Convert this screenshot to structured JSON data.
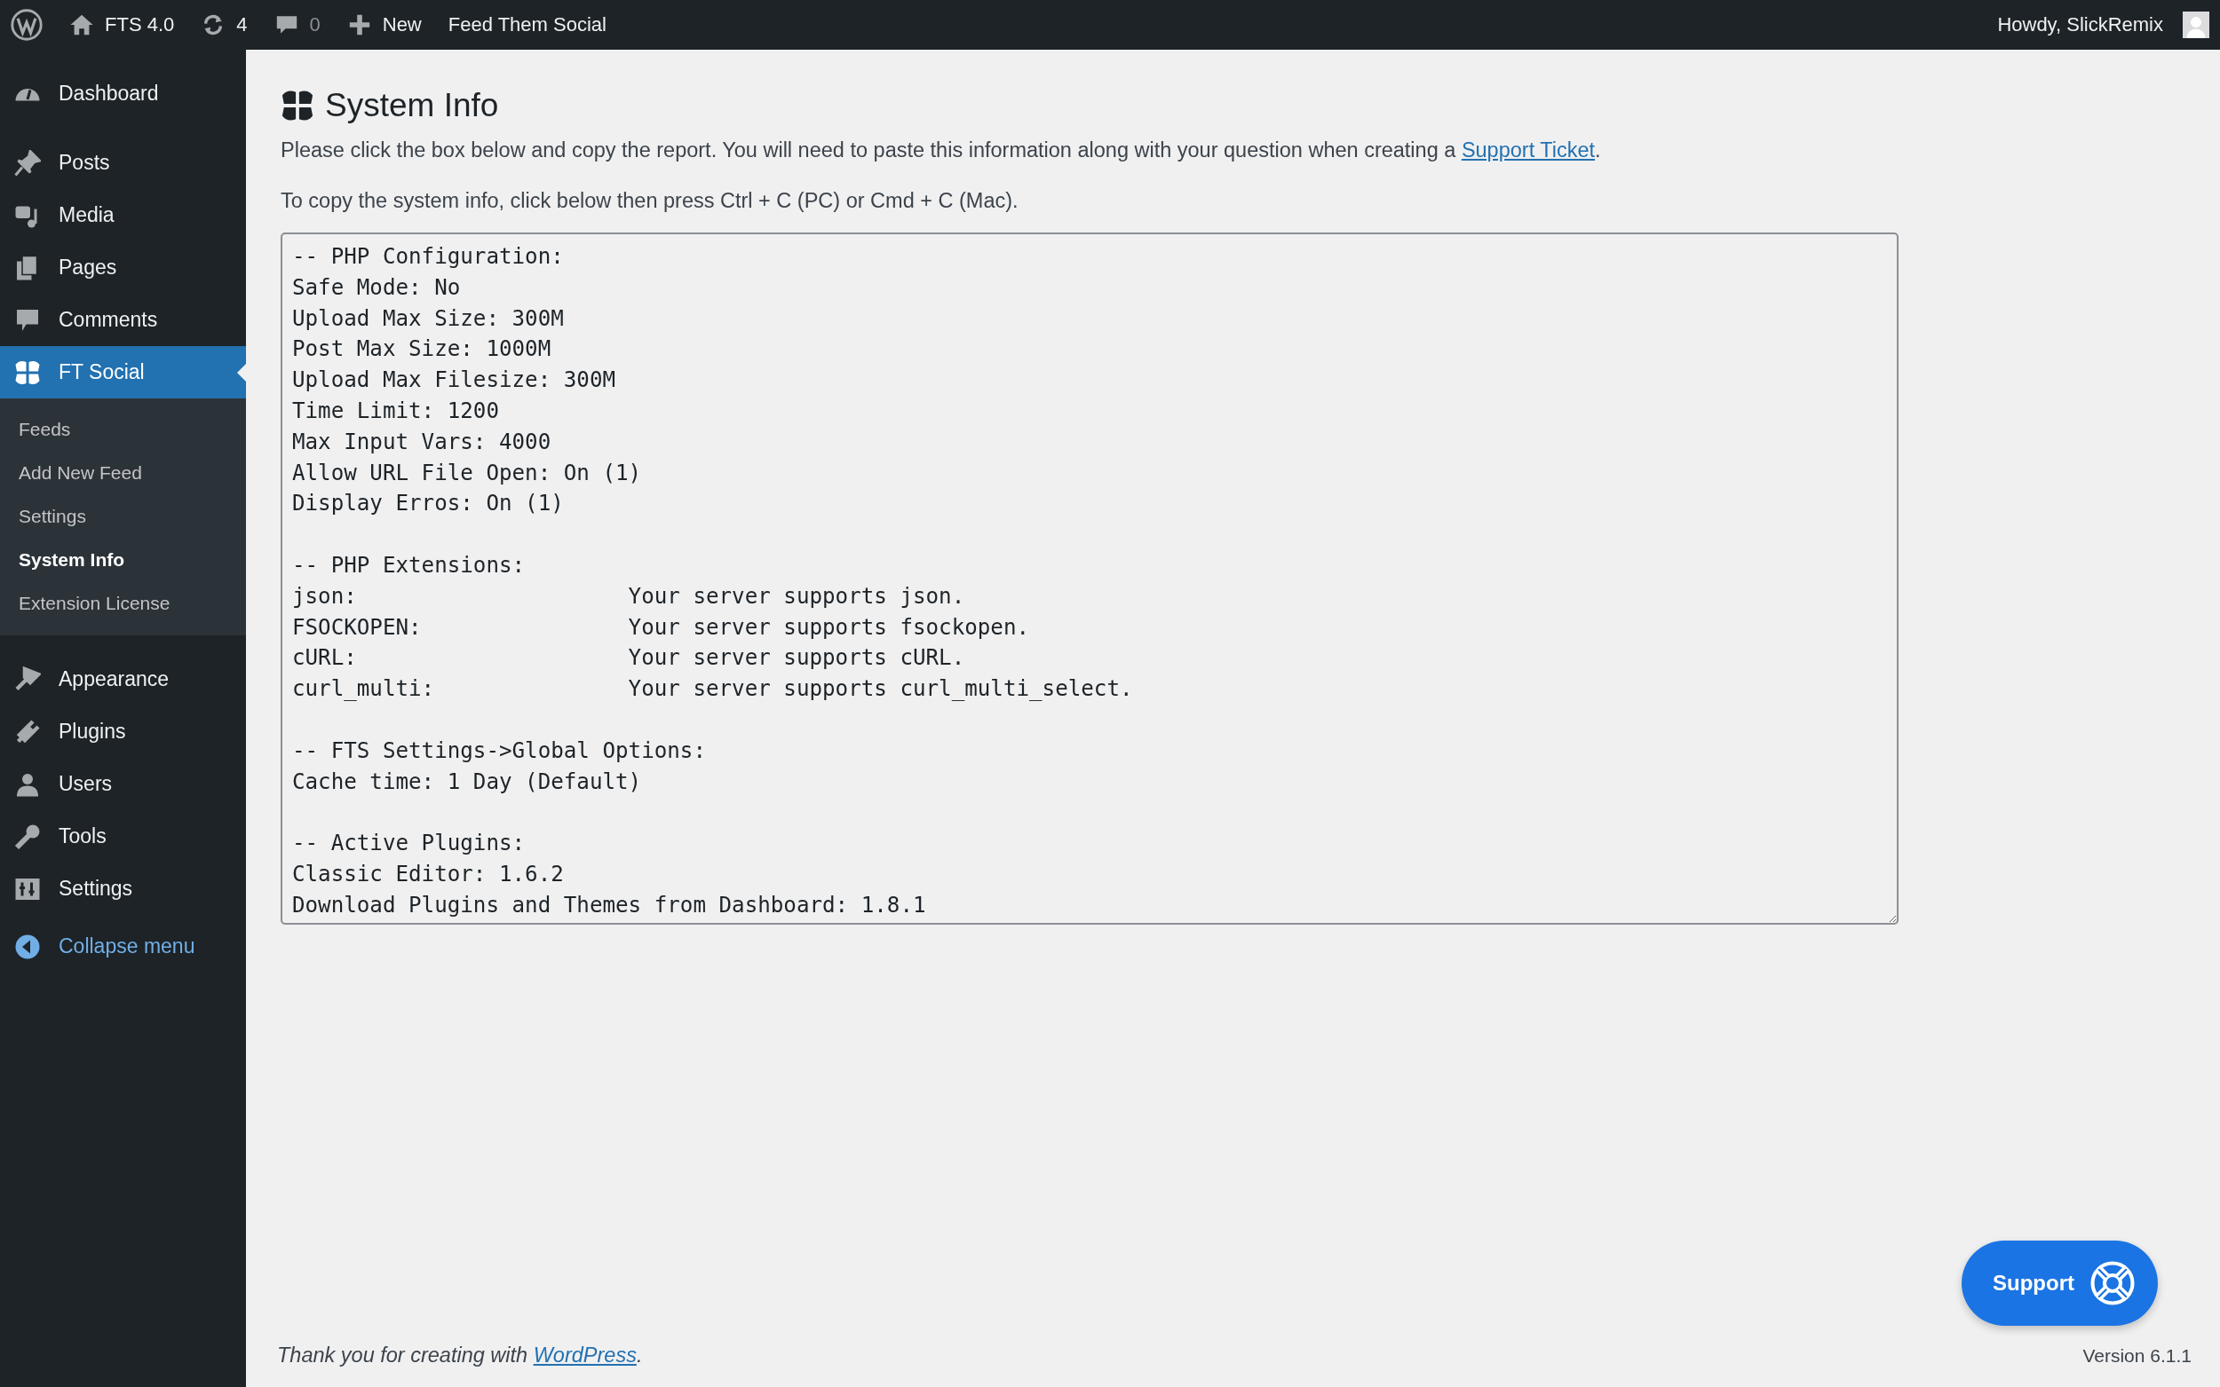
{
  "admin_bar": {
    "site": "FTS 4.0",
    "updates": "4",
    "comments": "0",
    "new": "New",
    "plugin": "Feed Them Social",
    "greeting": "Howdy, SlickRemix"
  },
  "sidebar": {
    "items": [
      {
        "label": "Dashboard",
        "selected": false
      },
      {
        "label": "Posts",
        "selected": false
      },
      {
        "label": "Media",
        "selected": false
      },
      {
        "label": "Pages",
        "selected": false
      },
      {
        "label": "Comments",
        "selected": false
      },
      {
        "label": "FT Social",
        "selected": true,
        "children": [
          {
            "label": "Feeds",
            "selected": false
          },
          {
            "label": "Add New Feed",
            "selected": false
          },
          {
            "label": "Settings",
            "selected": false
          },
          {
            "label": "System Info",
            "selected": true
          },
          {
            "label": "Extension License",
            "selected": false
          }
        ]
      },
      {
        "label": "Appearance",
        "selected": false
      },
      {
        "label": "Plugins",
        "selected": false
      },
      {
        "label": "Users",
        "selected": false
      },
      {
        "label": "Tools",
        "selected": false
      },
      {
        "label": "Settings",
        "selected": false
      }
    ],
    "collapse": "Collapse menu"
  },
  "page": {
    "title": "System Info",
    "intro": {
      "before": "Please click the box below and copy the report. You will need to paste this information along with your question when creating a ",
      "link": "Support Ticket",
      "after": "."
    },
    "hint": "To copy the system info, click below then press Ctrl + C (PC) or Cmd + C (Mac).",
    "report": "-- PHP Configuration:\nSafe Mode: No\nUpload Max Size: 300M\nPost Max Size: 1000M\nUpload Max Filesize: 300M\nTime Limit: 1200\nMax Input Vars: 4000\nAllow URL File Open: On (1)\nDisplay Erros: On (1)\n\n-- PHP Extensions:\njson:                     Your server supports json.\nFSOCKOPEN:                Your server supports fsockopen.\ncURL:                     Your server supports cURL.\ncurl_multi:               Your server supports curl_multi_select.\n\n-- FTS Settings->Global Options:\nCache time: 1 Day (Default)\n\n-- Active Plugins:\nClassic Editor: 1.6.2\nDownload Plugins and Themes from Dashboard: 1.8.1"
  },
  "support_button": "Support",
  "footer": {
    "before": "Thank you for creating with ",
    "link": "WordPress",
    "after": ".",
    "version": "Version 6.1.1"
  }
}
